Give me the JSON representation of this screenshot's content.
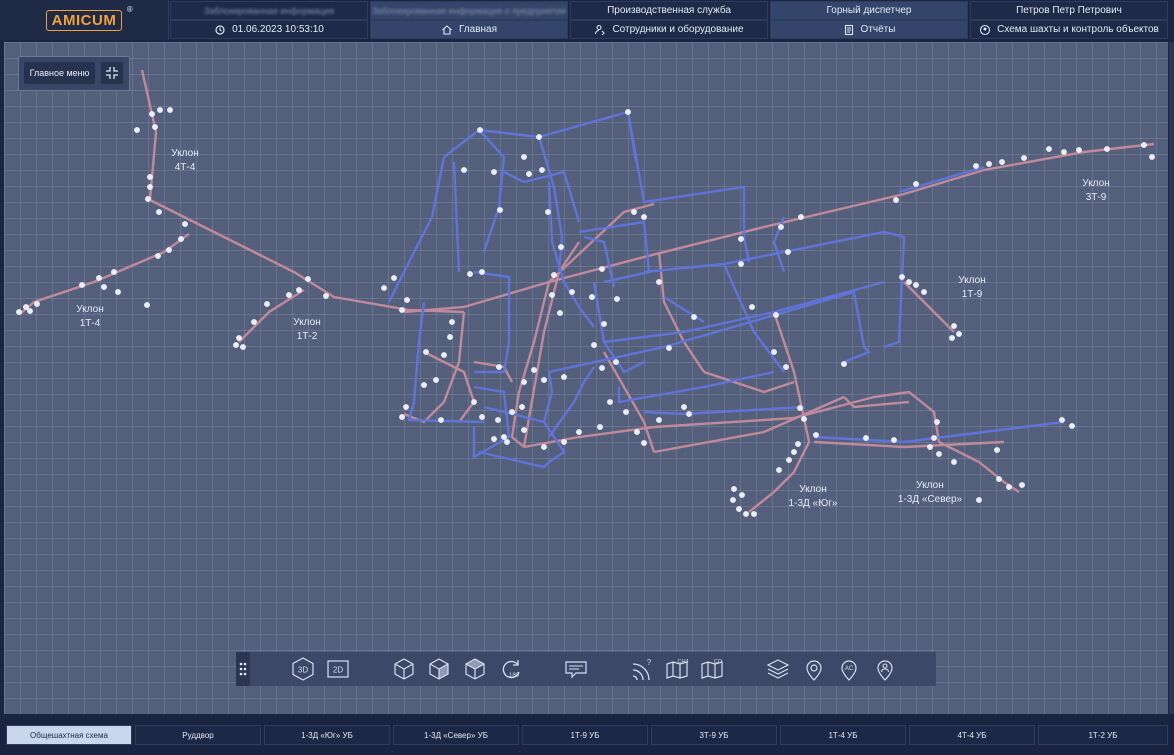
{
  "app": {
    "logo_text": "AMICUM",
    "logo_mark": "®"
  },
  "header": {
    "top_row": [
      {
        "label": "Заблокированная информация",
        "blurred": true
      },
      {
        "label": "Заблокированная информация о предприятии",
        "blurred": true
      },
      {
        "label": "Производственная служба"
      },
      {
        "label": "Горный диспетчер"
      },
      {
        "label": "Петров Петр Петрович"
      }
    ],
    "datetime": "01.06.2023  10:53:10",
    "nav": [
      {
        "label": "Главная",
        "icon": "home-icon"
      },
      {
        "label": "Сотрудники и оборудование",
        "icon": "workers-equipment-icon"
      },
      {
        "label": "Отчёты",
        "icon": "report-icon"
      },
      {
        "label": "Схема шахты и контроль объектов",
        "icon": "map-pin-icon"
      }
    ]
  },
  "main_menu": {
    "label": "Главное меню",
    "collapse_icon": "collapse-icon"
  },
  "map_labels": [
    {
      "id": "4t4",
      "lines": [
        "Уклон",
        "4Т-4"
      ]
    },
    {
      "id": "1t4",
      "lines": [
        "Уклон",
        "1Т-4"
      ]
    },
    {
      "id": "1t2",
      "lines": [
        "Уклон",
        "1Т-2"
      ]
    },
    {
      "id": "3t9",
      "lines": [
        "Уклон",
        "3Т-9"
      ]
    },
    {
      "id": "1t9",
      "lines": [
        "Уклон",
        "1Т-9"
      ]
    },
    {
      "id": "1zd_yug",
      "lines": [
        "Уклон",
        "1-3Д «Юг»"
      ]
    },
    {
      "id": "1zd_sever",
      "lines": [
        "Уклон",
        "1-3Д «Север»"
      ]
    }
  ],
  "toolbar": [
    {
      "name": "3d-view-button",
      "text": "3D"
    },
    {
      "name": "2d-view-button",
      "text": "2D"
    },
    {
      "name": "cube-front-button",
      "text": ""
    },
    {
      "name": "cube-side-button",
      "text": ""
    },
    {
      "name": "cube-top-button",
      "text": ""
    },
    {
      "name": "rotate-180-button",
      "text": "180"
    },
    {
      "name": "messages-button",
      "text": ""
    },
    {
      "name": "signal-query-button",
      "text": "?"
    },
    {
      "name": "ch4-map-button",
      "text": "CH4"
    },
    {
      "name": "co-map-button",
      "text": "CO"
    },
    {
      "name": "layers-button",
      "text": ""
    },
    {
      "name": "location-pin-button",
      "text": ""
    },
    {
      "name": "ac-pin-button",
      "text": "AC"
    },
    {
      "name": "person-pin-button",
      "text": ""
    }
  ],
  "bottom_tabs": [
    {
      "label": "Общешахтная схема",
      "active": true
    },
    {
      "label": "Руддвор"
    },
    {
      "label": "1-3Д «Юг» УБ"
    },
    {
      "label": "1-3Д «Север» УБ"
    },
    {
      "label": "1Т-9 УБ"
    },
    {
      "label": "3Т-9 УБ"
    },
    {
      "label": "1Т-4 УБ"
    },
    {
      "label": "4Т-4 УБ"
    },
    {
      "label": "1Т-2 УБ"
    }
  ],
  "colors": {
    "airway_intake": "#c08a9a",
    "airway_blue": "#5f74d8",
    "node": "#e8ecf5"
  }
}
